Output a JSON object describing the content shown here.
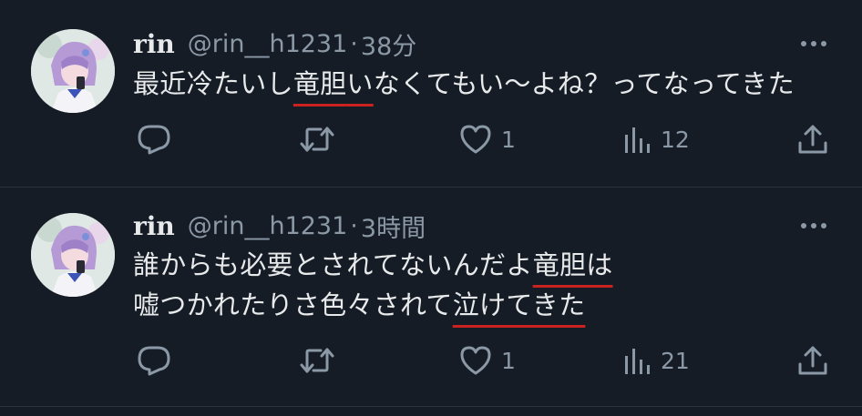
{
  "posts": [
    {
      "name": "rin",
      "handle": "@rin__h1231",
      "separator": "·",
      "time": "38分",
      "text_parts": [
        "最近冷たいし",
        "竜胆",
        "い",
        "なくてもい〜よね？ってなってきた"
      ],
      "likes": "1",
      "views": "12"
    },
    {
      "name": "rin",
      "handle": "@rin__h1231",
      "separator": "·",
      "time": "3時間",
      "line1_parts": [
        "誰からも必要とされてないんだよ",
        "竜胆は"
      ],
      "line2_parts": [
        "嘘つかれたりさ色々されて",
        "泣けてきた"
      ],
      "likes": "1",
      "views": "21"
    }
  ],
  "icons": {
    "more": "more-icon",
    "reply": "reply-icon",
    "retweet": "retweet-icon",
    "like": "heart-icon",
    "views": "views-icon",
    "share": "share-icon"
  },
  "colors": {
    "background": "#151c26",
    "text": "#e7e9ea",
    "secondary": "#8b98a5",
    "underline": "#c9221f"
  }
}
